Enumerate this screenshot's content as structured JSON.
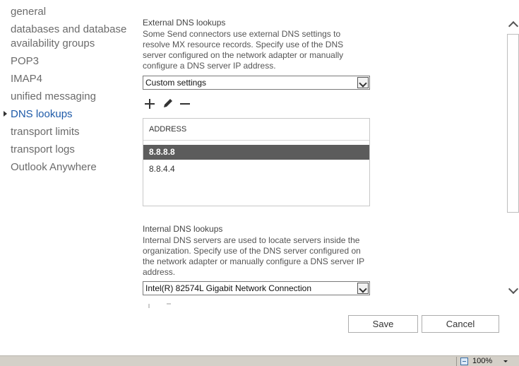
{
  "nav": {
    "items": [
      {
        "label": "general"
      },
      {
        "label": "databases and database"
      },
      {
        "label": "availability groups"
      },
      {
        "label": "POP3"
      },
      {
        "label": "IMAP4"
      },
      {
        "label": "unified messaging"
      },
      {
        "label": "DNS lookups"
      },
      {
        "label": "transport limits"
      },
      {
        "label": "transport logs"
      },
      {
        "label": "Outlook Anywhere"
      }
    ],
    "active": "DNS lookups"
  },
  "external": {
    "title": "External DNS lookups",
    "description": "Some Send connectors use external DNS settings to resolve MX resource records. Specify use of the DNS server configured on the network adapter or manually configure a DNS server IP address.",
    "selected": "Custom settings",
    "list": {
      "header": "ADDRESS",
      "rows": [
        "8.8.8.8",
        "8.8.4.4"
      ],
      "selected_index": 0
    }
  },
  "internal": {
    "title": "Internal DNS lookups",
    "description": "Internal DNS servers are used to locate servers inside the organization. Specify use of the DNS server configured on the network adapter or manually configure a DNS server IP address.",
    "selected": "Intel(R) 82574L Gigabit Network Connection"
  },
  "buttons": {
    "save": "Save",
    "cancel": "Cancel"
  },
  "statusbar": {
    "zoom": "100%"
  }
}
